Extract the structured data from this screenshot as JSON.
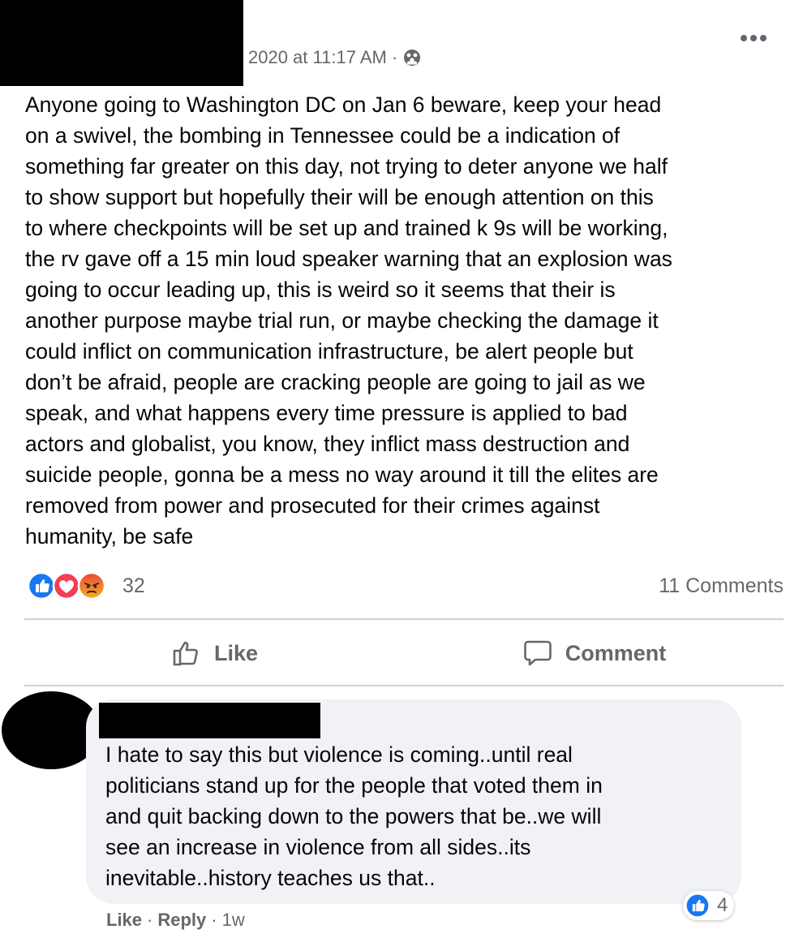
{
  "post": {
    "timestamp": "2020 at 11:17 AM",
    "meta_separator": "·",
    "body": "Anyone going to Washington DC on Jan 6 beware, keep your head\non a swivel, the bombing in Tennessee could be a indication of\nsomething far greater on this day, not trying to deter anyone we half\nto show support but hopefully their will be enough attention on this\nto where checkpoints will be set up and trained k 9s will be working,\nthe rv gave off a 15 min loud speaker warning that an explosion was\ngoing to occur leading up, this is weird so it seems that their is\nanother purpose maybe trial run, or maybe checking the damage it\ncould inflict on communication infrastructure, be alert people but\ndon’t be afraid, people are cracking people are going to jail as we\nspeak, and what happens every time pressure is applied to bad\nactors and globalist, you know, they inflict mass destruction and\nsuicide people,  gonna be a mess no way around it till the elites are\nremoved from power and prosecuted for their crimes against\nhumanity, be safe",
    "reaction_count": "32",
    "reaction_icons": [
      "like-icon",
      "love-icon",
      "angry-icon"
    ],
    "comment_count": "11 Comments"
  },
  "actions": {
    "like_label": "Like",
    "comment_label": "Comment"
  },
  "comment": {
    "text": "I hate to say this but violence is coming..until real\npoliticians stand up for the people that voted them in\nand quit backing down to the powers that be..we will\nsee an increase in violence from all sides..its\ninevitable..history teaches us that..",
    "reaction_count": "4",
    "like_label": "Like",
    "separator": "·",
    "reply_label": "Reply",
    "age": "1w"
  },
  "colors": {
    "like_blue": "#1877f2",
    "love_red": "#f33e58",
    "angry_orange": "#f7714c",
    "secondary_text": "#65676b",
    "bubble_bg": "#f0f2f5"
  }
}
